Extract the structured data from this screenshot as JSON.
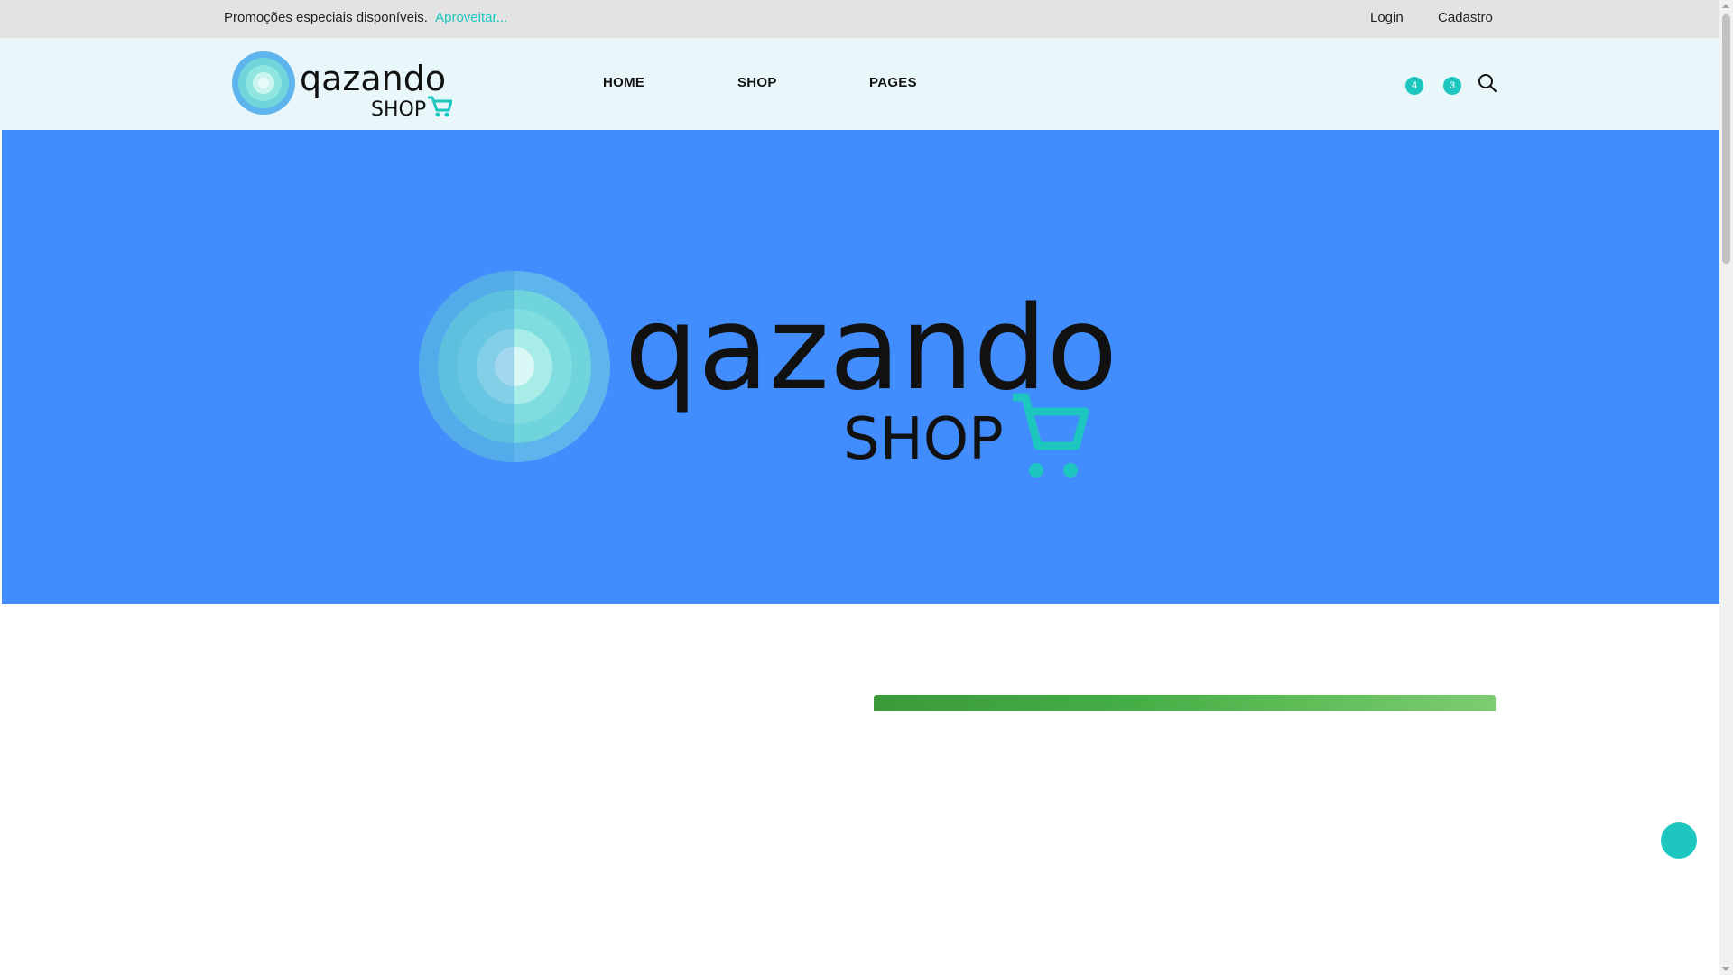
{
  "promo": {
    "text": "Promoções especiais disponíveis.",
    "link": "Aproveitar..."
  },
  "auth": {
    "login": "Login",
    "register": "Cadastro"
  },
  "brand": {
    "name": "Qazando",
    "sub": "SHOP"
  },
  "nav": {
    "items": [
      {
        "label": "HOME"
      },
      {
        "label": "SHOP"
      },
      {
        "label": "PAGES"
      }
    ]
  },
  "header_icons": {
    "wishlist_count": "4",
    "cart_count": "3",
    "search_icon": "search-icon"
  },
  "colors": {
    "accent": "#1ec6c0",
    "hero_bg": "#428dfd",
    "header_bg": "#e9f7fb",
    "promo_bg": "#e3e3e3"
  }
}
